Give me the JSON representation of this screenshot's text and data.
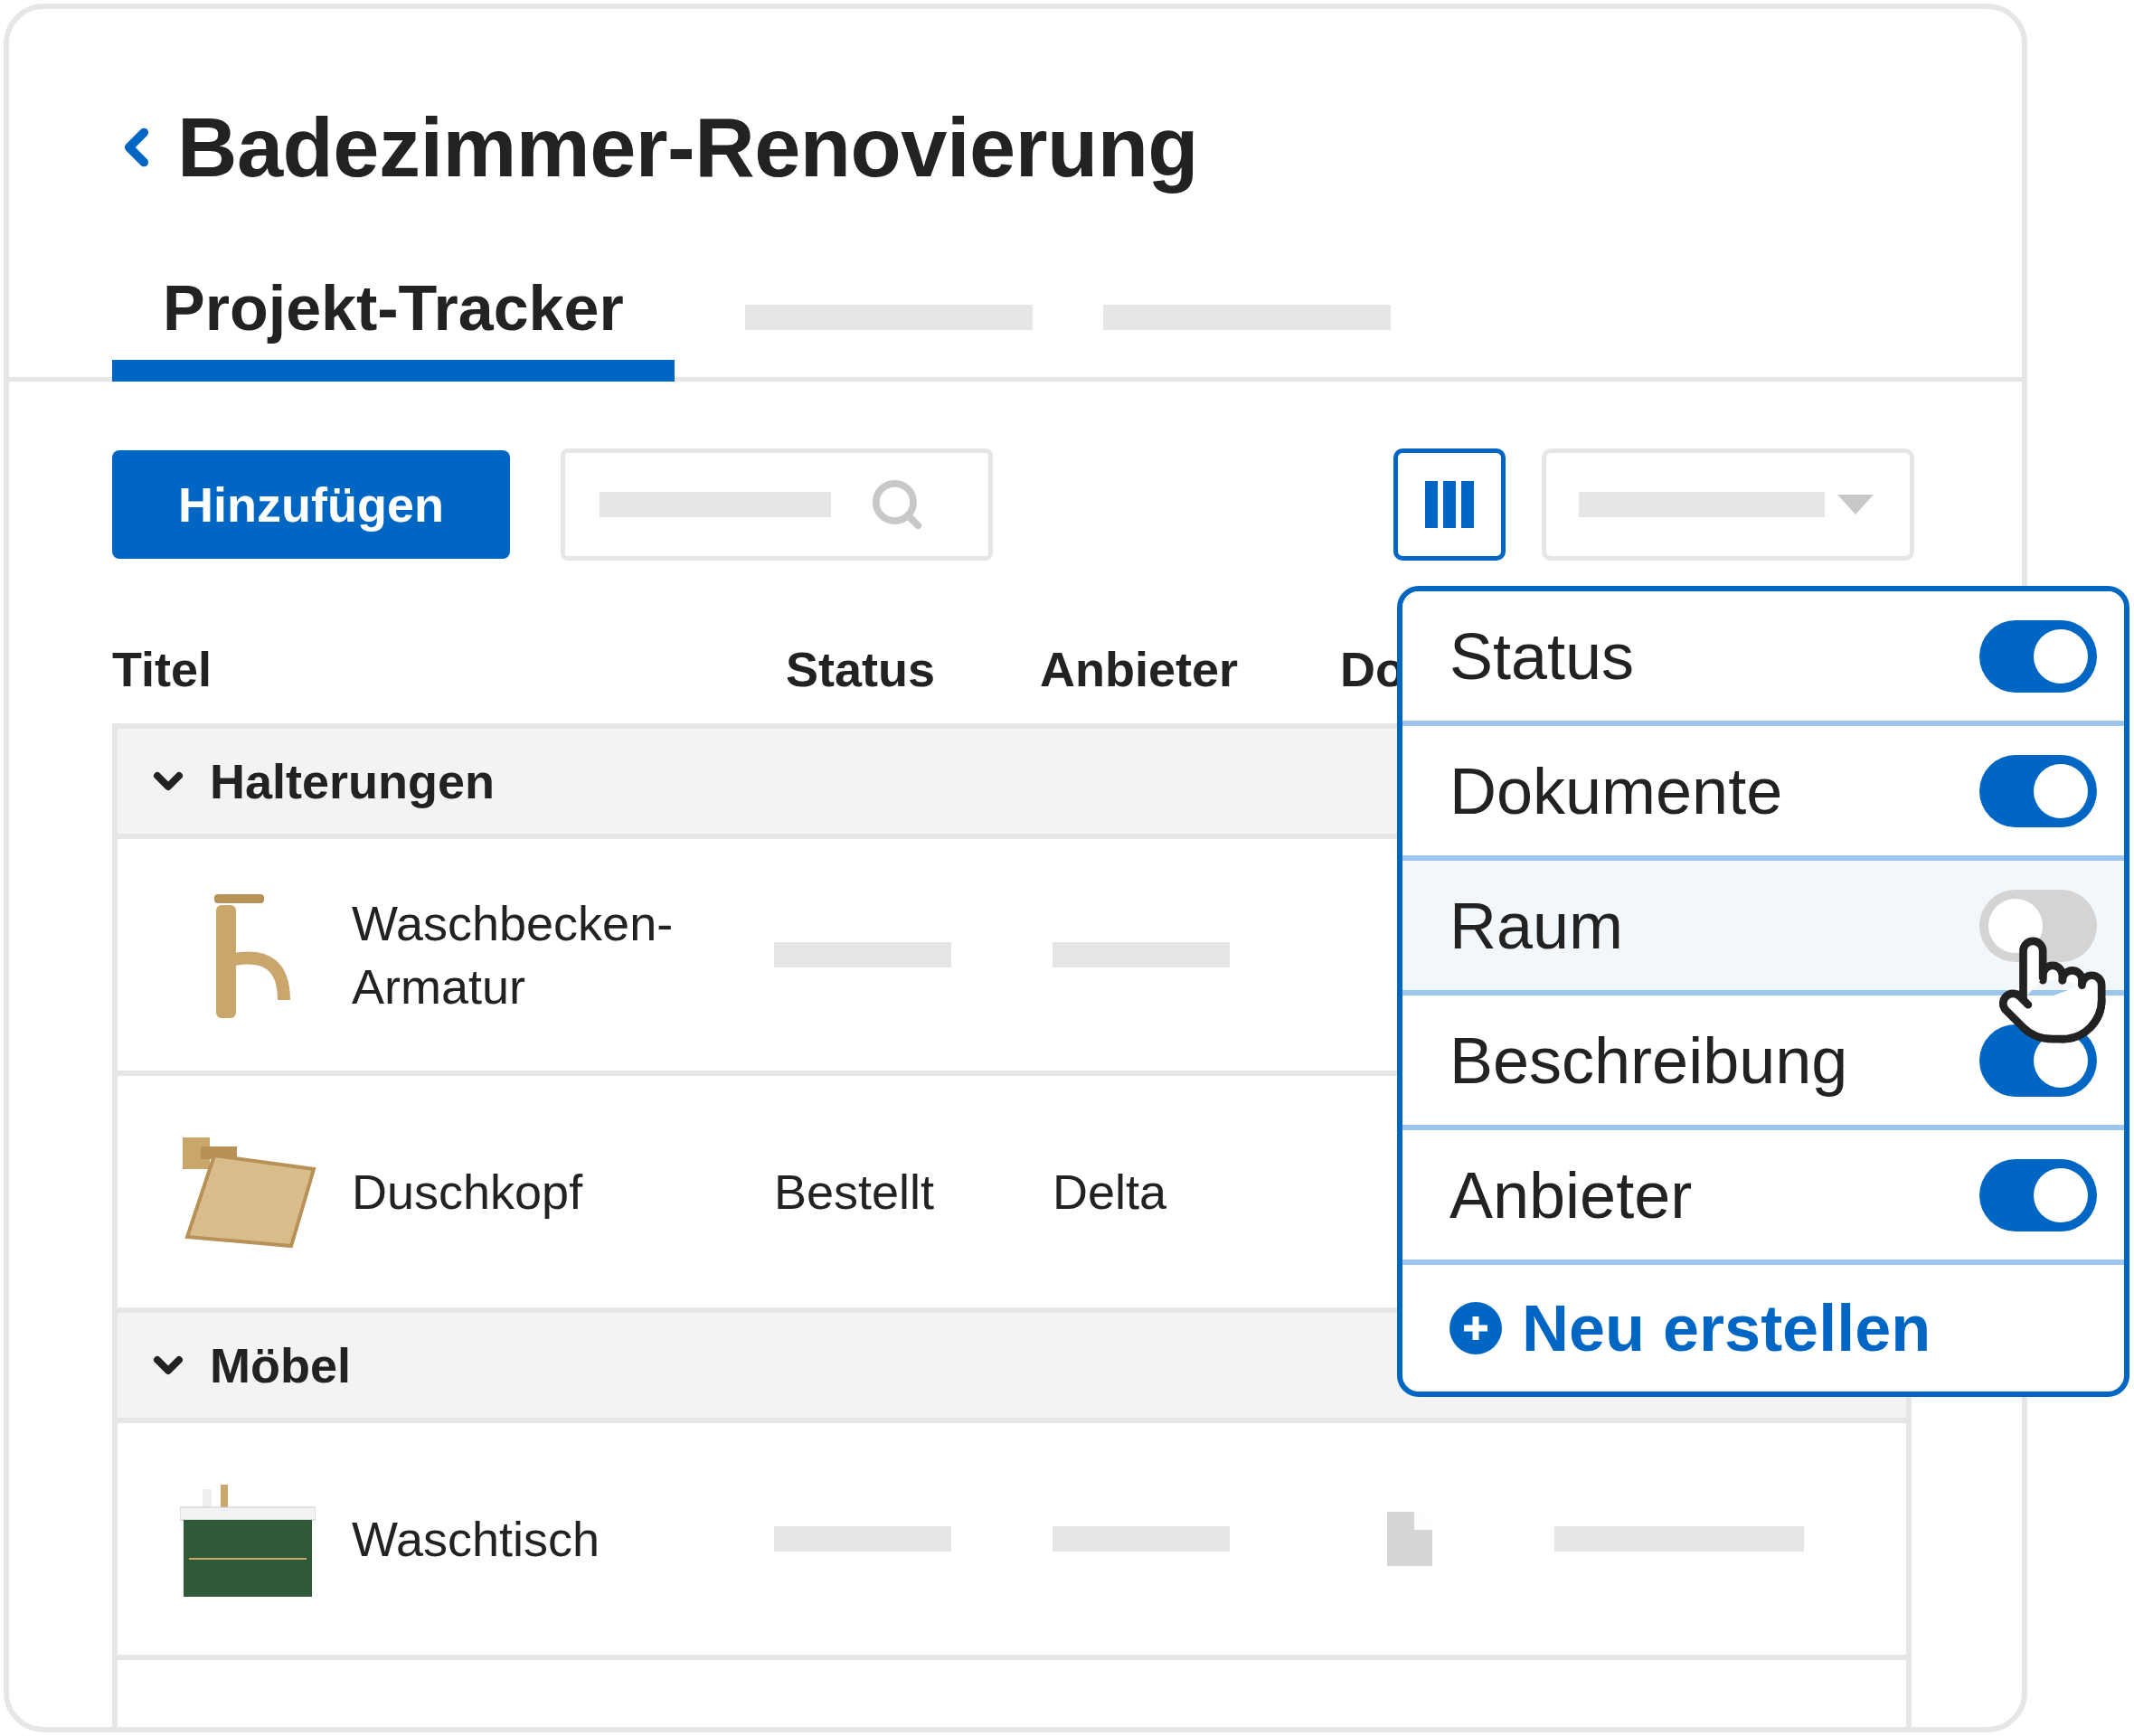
{
  "header": {
    "title": "Badezimmer-Renovierung"
  },
  "tabs": [
    {
      "kind": "text",
      "label": "Projekt-Tracker",
      "selected": true
    },
    {
      "kind": "placeholder",
      "selected": false
    },
    {
      "kind": "placeholder",
      "selected": false
    }
  ],
  "toolbar": {
    "add_button": "Hinzufügen"
  },
  "table": {
    "columns": [
      "Titel",
      "Status",
      "Anbieter",
      "Do"
    ],
    "groups": [
      {
        "name": "Halterungen",
        "expanded": true,
        "rows": [
          {
            "kind": "faucet",
            "title": "Waschbecken-Armatur",
            "document": false
          },
          {
            "kind": "shower_head",
            "title": "Duschkopf",
            "status": "Bestellt",
            "vendor": "Delta",
            "document": false
          }
        ]
      },
      {
        "name": "Möbel",
        "expanded": true,
        "rows": [
          {
            "kind": "vanity",
            "title": "Waschtisch",
            "document": true
          }
        ]
      }
    ]
  },
  "column_menu": {
    "items": [
      {
        "label": "Status",
        "on": true,
        "hovered": false
      },
      {
        "label": "Dokumente",
        "on": true,
        "hovered": false
      },
      {
        "label": "Raum",
        "on": false,
        "hovered": true
      },
      {
        "label": "Beschreibung",
        "on": true,
        "hovered": false
      },
      {
        "label": "Anbieter",
        "on": true,
        "hovered": false
      }
    ],
    "create_label": "Neu erstellen"
  }
}
